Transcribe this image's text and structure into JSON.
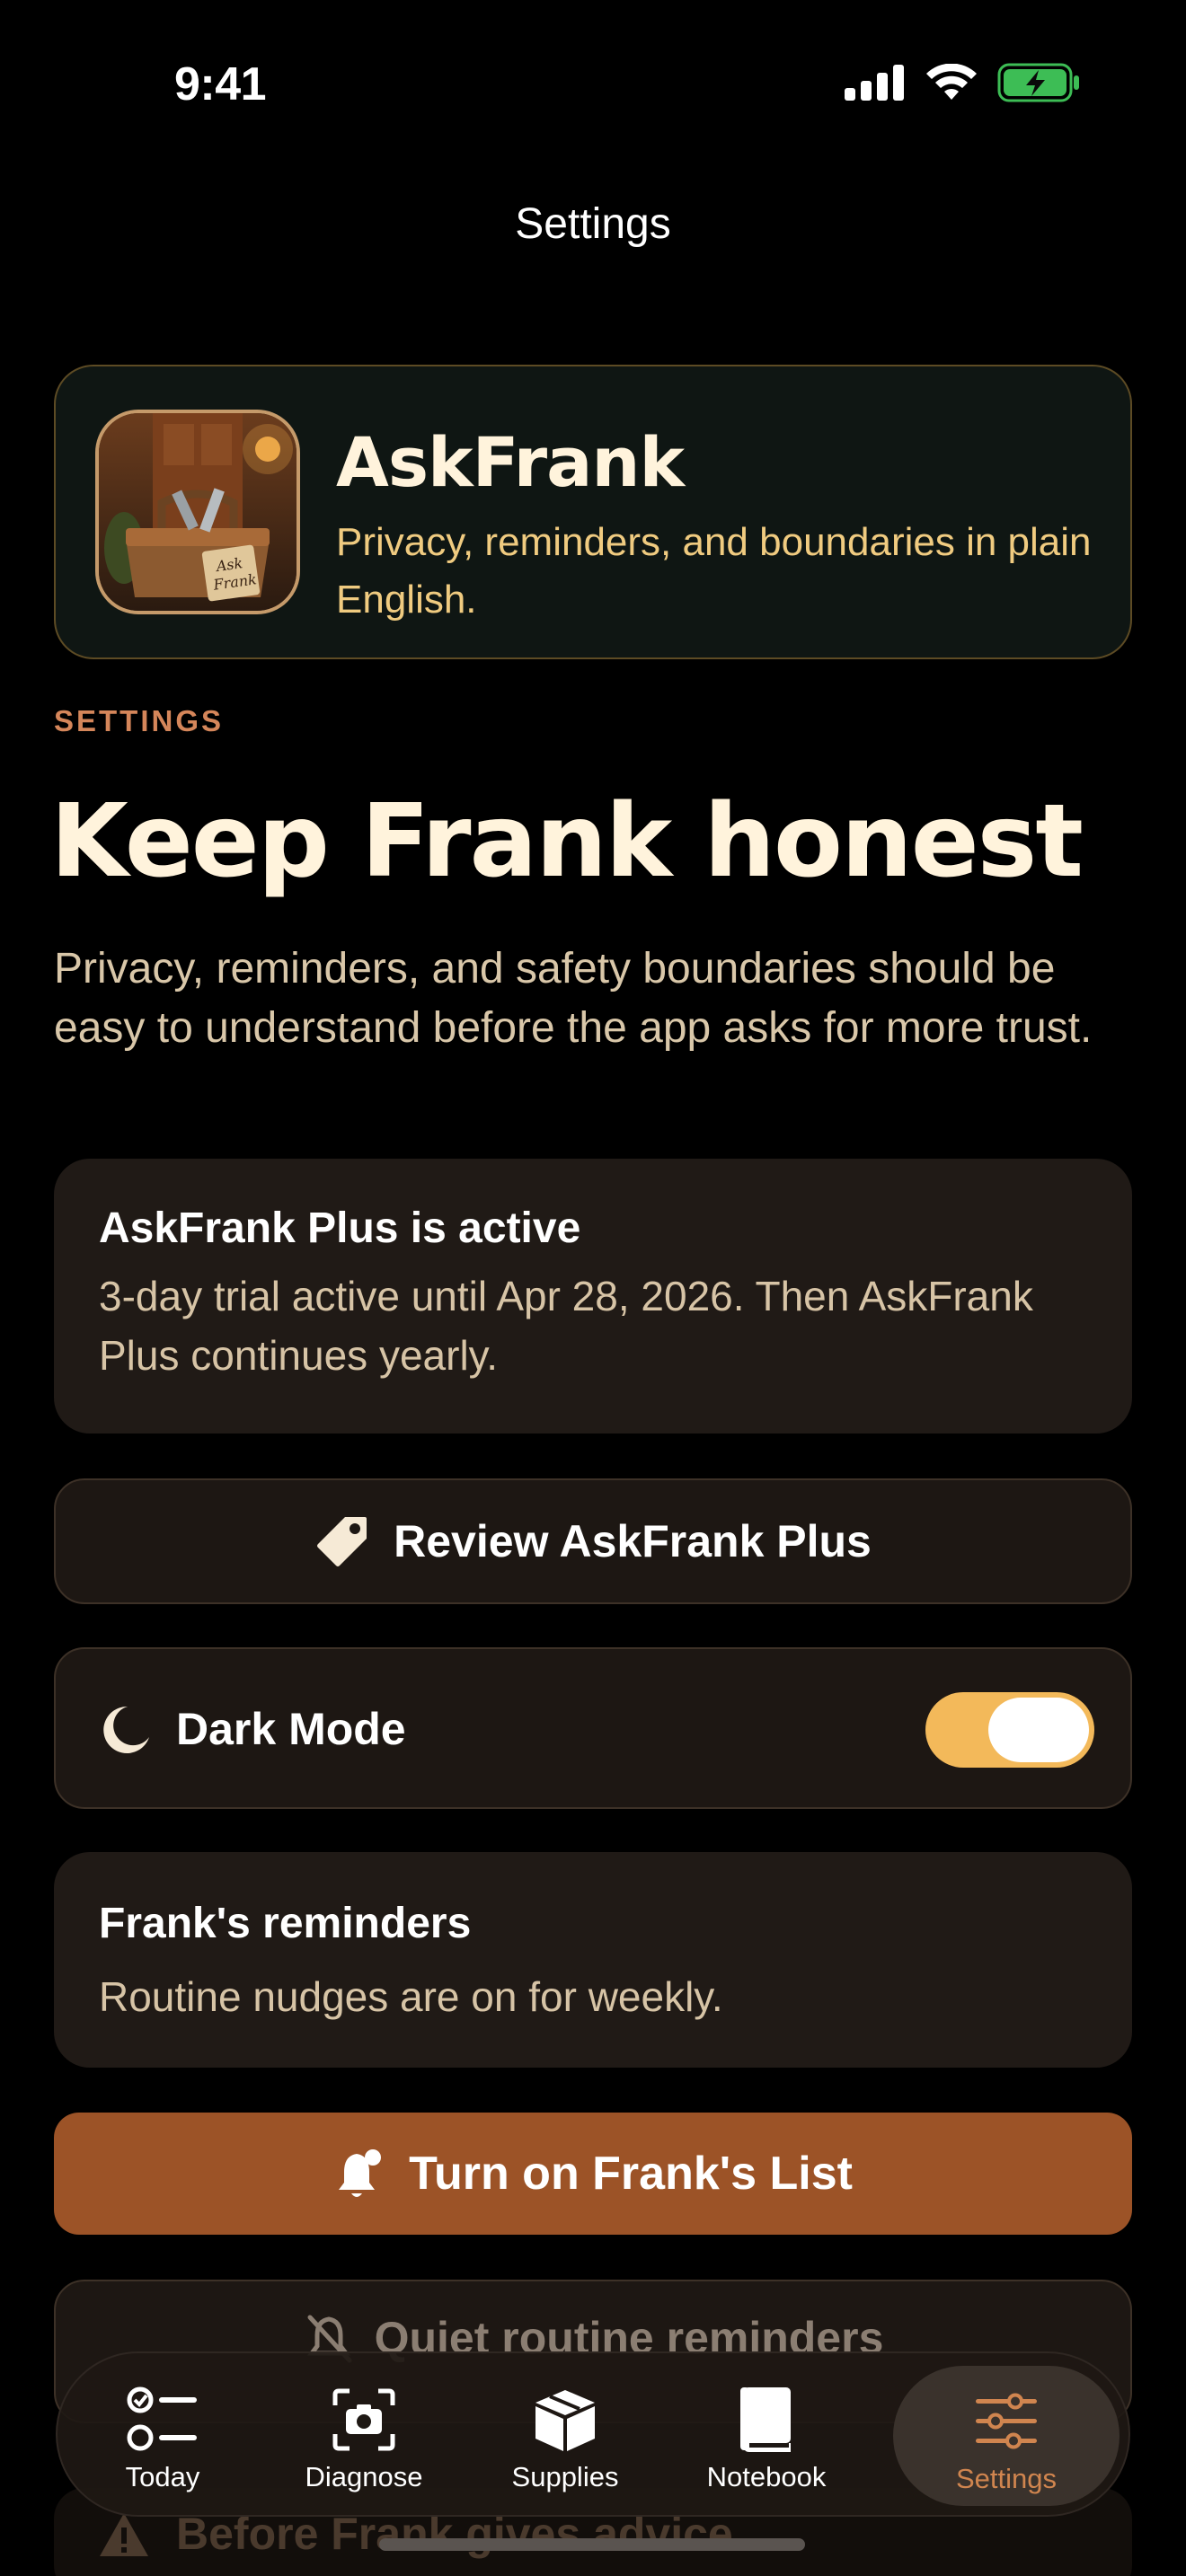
{
  "status_bar": {
    "time": "9:41"
  },
  "nav": {
    "title": "Settings"
  },
  "brand": {
    "name": "AskFrank",
    "subtitle": "Privacy, reminders, and boundaries in plain English.",
    "icon_tag_text": "Ask Frank"
  },
  "section_label": "SETTINGS",
  "page_title": "Keep Frank honest",
  "page_description": "Privacy, reminders, and safety boundaries should be easy to understand before the app asks for more trust.",
  "plus_card": {
    "title": "AskFrank Plus is active",
    "text": "3-day trial active until Apr 28, 2026. Then AskFrank Plus continues yearly."
  },
  "review_button": {
    "label": "Review AskFrank Plus",
    "icon": "tag-icon"
  },
  "dark_mode": {
    "label": "Dark Mode",
    "icon": "moon-icon",
    "enabled": true
  },
  "reminders_card": {
    "title": "Frank's reminders",
    "text": "Routine nudges are on for weekly."
  },
  "frank_list_button": {
    "label": "Turn on Frank's List",
    "icon": "bell-badge-icon"
  },
  "quiet_button": {
    "label": "Quiet routine reminders",
    "icon": "bell-slash-icon"
  },
  "before_advice_row": {
    "label": "Before Frank gives advice",
    "icon": "warning-icon"
  },
  "tabs": [
    {
      "label": "Today",
      "icon": "checklist-icon",
      "active": false
    },
    {
      "label": "Diagnose",
      "icon": "camera-viewfinder-icon",
      "active": false
    },
    {
      "label": "Supplies",
      "icon": "box-icon",
      "active": false
    },
    {
      "label": "Notebook",
      "icon": "book-icon",
      "active": false
    },
    {
      "label": "Settings",
      "icon": "sliders-icon",
      "active": true
    }
  ],
  "colors": {
    "background": "#000000",
    "card": "#201a16",
    "accent_orange": "#9c5327",
    "toggle_on": "#f3b95a",
    "active_tab": "#d0854f",
    "section_label": "#d5865a"
  }
}
